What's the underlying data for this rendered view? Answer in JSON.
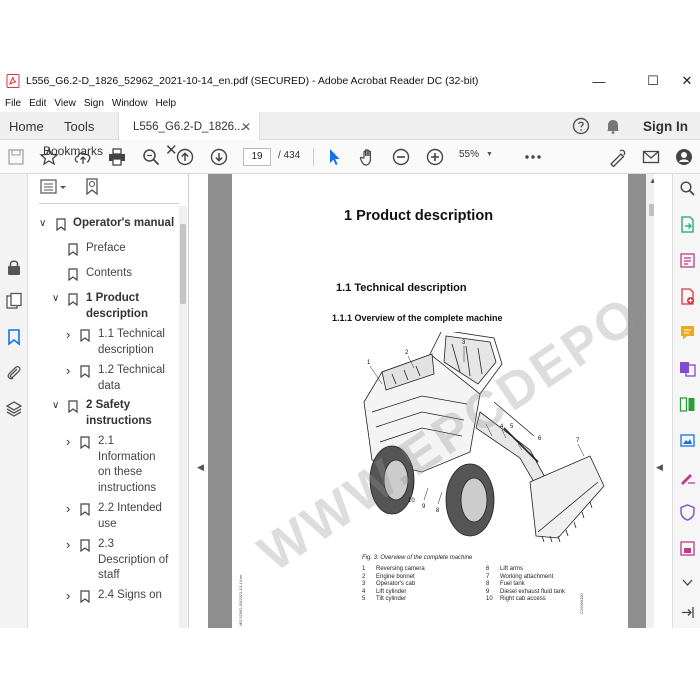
{
  "window": {
    "title": "L556_G6.2-D_1826_52962_2021-10-14_en.pdf (SECURED) - Adobe Acrobat Reader DC (32-bit)",
    "minimize": "—",
    "maximize": "☐",
    "close": "✕"
  },
  "menu": [
    "File",
    "Edit",
    "View",
    "Sign",
    "Window",
    "Help"
  ],
  "tabs": {
    "home": "Home",
    "tools": "Tools",
    "document": "L556_G6.2-D_1826...",
    "close": "✕",
    "sign_in": "Sign In"
  },
  "toolbar": {
    "page_current": "19",
    "page_total": "/  434",
    "zoom": "55%",
    "zoom_caret": "▼"
  },
  "bookmarks": {
    "title": "Bookmarks",
    "close": "✕",
    "items": [
      {
        "label": "Operator's manual",
        "bold": true,
        "caret": "∨"
      },
      {
        "label": "Preface",
        "bold": false,
        "caret": ""
      },
      {
        "label": "Contents",
        "bold": false,
        "caret": ""
      },
      {
        "label": "1 Product",
        "label2": "description",
        "bold": true,
        "caret": "∨"
      },
      {
        "label": "1.1 Technical",
        "label2": "description",
        "bold": false,
        "caret": "›"
      },
      {
        "label": "1.2 Technical",
        "label2": "data",
        "bold": false,
        "caret": "›"
      },
      {
        "label": "2 Safety",
        "label2": "instructions",
        "bold": true,
        "caret": "∨"
      },
      {
        "label": "2.1",
        "label2": "Information",
        "label3": "on these",
        "label4": "instructions",
        "bold": false,
        "caret": "›"
      },
      {
        "label": "2.2 Intended",
        "label2": "use",
        "bold": false,
        "caret": "›"
      },
      {
        "label": "2.3",
        "label2": "Description of",
        "label3": "staff",
        "bold": false,
        "caret": "›"
      },
      {
        "label": "2.4 Signs on",
        "bold": false,
        "caret": "›"
      }
    ]
  },
  "document": {
    "heading1": "1  Product description",
    "heading2": "1.1  Technical description",
    "heading3": "1.1.1  Overview of the complete machine",
    "figure_caption": "Fig. 3: Overview of the complete machine",
    "figure_callouts": [
      "1",
      "2",
      "3",
      "4",
      "5",
      "6",
      "7",
      "8",
      "9",
      "10"
    ],
    "legend": [
      {
        "n": "1",
        "t": "Reversing camera"
      },
      {
        "n": "2",
        "t": "Engine bonnet"
      },
      {
        "n": "3",
        "t": "Operator's cab"
      },
      {
        "n": "4",
        "t": "Lift cylinder"
      },
      {
        "n": "5",
        "t": "Tilt cylinder"
      },
      {
        "n": "6",
        "t": "Lift arms"
      },
      {
        "n": "7",
        "t": "Working attachment"
      },
      {
        "n": "8",
        "t": "Fuel tank"
      },
      {
        "n": "9",
        "t": "Diesel exhaust fluid tank"
      },
      {
        "n": "10",
        "t": "Right cab access"
      }
    ],
    "figure_code": "C20090100",
    "side_code": "MD 52962-03/2021-13-14 en",
    "watermark": "WWW.EPCDEPO.COM"
  },
  "colors": {
    "accent": "#1473e6",
    "pdf_red": "#d7373f",
    "doc_bg": "#8e8e8e"
  }
}
